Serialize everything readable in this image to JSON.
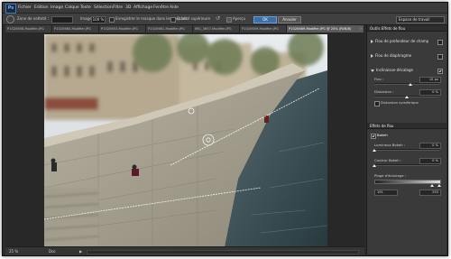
{
  "app": {
    "logo": "Ps"
  },
  "menu": [
    "Fichier",
    "Edition",
    "Image",
    "Calque",
    "Texte",
    "Sélection",
    "Filtre",
    "3D",
    "Affichage",
    "Fenêtre",
    "Aide"
  ],
  "window_controls": [
    "_",
    "□",
    "×"
  ],
  "options": {
    "focus_label": "Zone de netteté :",
    "focus_value": "",
    "image_label": "Image",
    "image_value": "100 %",
    "save_mask_label": "Enregistrer le masque dans les couches",
    "high_quality_label": "Qualité supérieure",
    "preview_label": "Aperçu",
    "ok_label": "OK",
    "cancel_label": "Annuler",
    "workspace_label": "Espace de travail"
  },
  "tabs": [
    {
      "label": "P1020658-Modifier.JPG",
      "active": false
    },
    {
      "label": "P1020660-Modifier.JPG",
      "active": false
    },
    {
      "label": "P1020653-Modifier.JPG",
      "active": false
    },
    {
      "label": "P1020661-Modifier.JPG",
      "active": false
    },
    {
      "label": "IMG_3657-Modifier.JPG",
      "active": false
    },
    {
      "label": "P1020659-Modifier.JPG",
      "active": false
    },
    {
      "label": "P1020669-Modifier.JPG @ 25% (RVB/8)",
      "active": true
    }
  ],
  "status": {
    "zoom": "25 %",
    "doc": "Doc"
  },
  "panel": {
    "header": "Outils Effets de flou",
    "sections": [
      {
        "label": "Flou de profondeur de champ",
        "expanded": false,
        "checked": false
      },
      {
        "label": "Flou de diaphragme",
        "expanded": false,
        "checked": false
      },
      {
        "label": "Inclinaison-décalage",
        "expanded": true,
        "checked": true
      }
    ],
    "tilt": {
      "blur_label": "Flou :",
      "blur_value": "15 px",
      "blur_level": 0.55,
      "distortion_label": "Distorsion :",
      "distortion_value": "0 %",
      "distortion_level": 0.5,
      "symmetric_label": "Distorsion symétrique"
    },
    "effects_header": "Effets de flou",
    "bokeh": {
      "label": "Bokeh",
      "checked": true,
      "light_label": "Lumineux Bokeh :",
      "light_value": "0 %",
      "color_label": "Couleur Bokeh :",
      "color_value": "0 %",
      "range_label": "Plage d'éclairage :",
      "range_low": "191",
      "range_high": "255"
    }
  }
}
